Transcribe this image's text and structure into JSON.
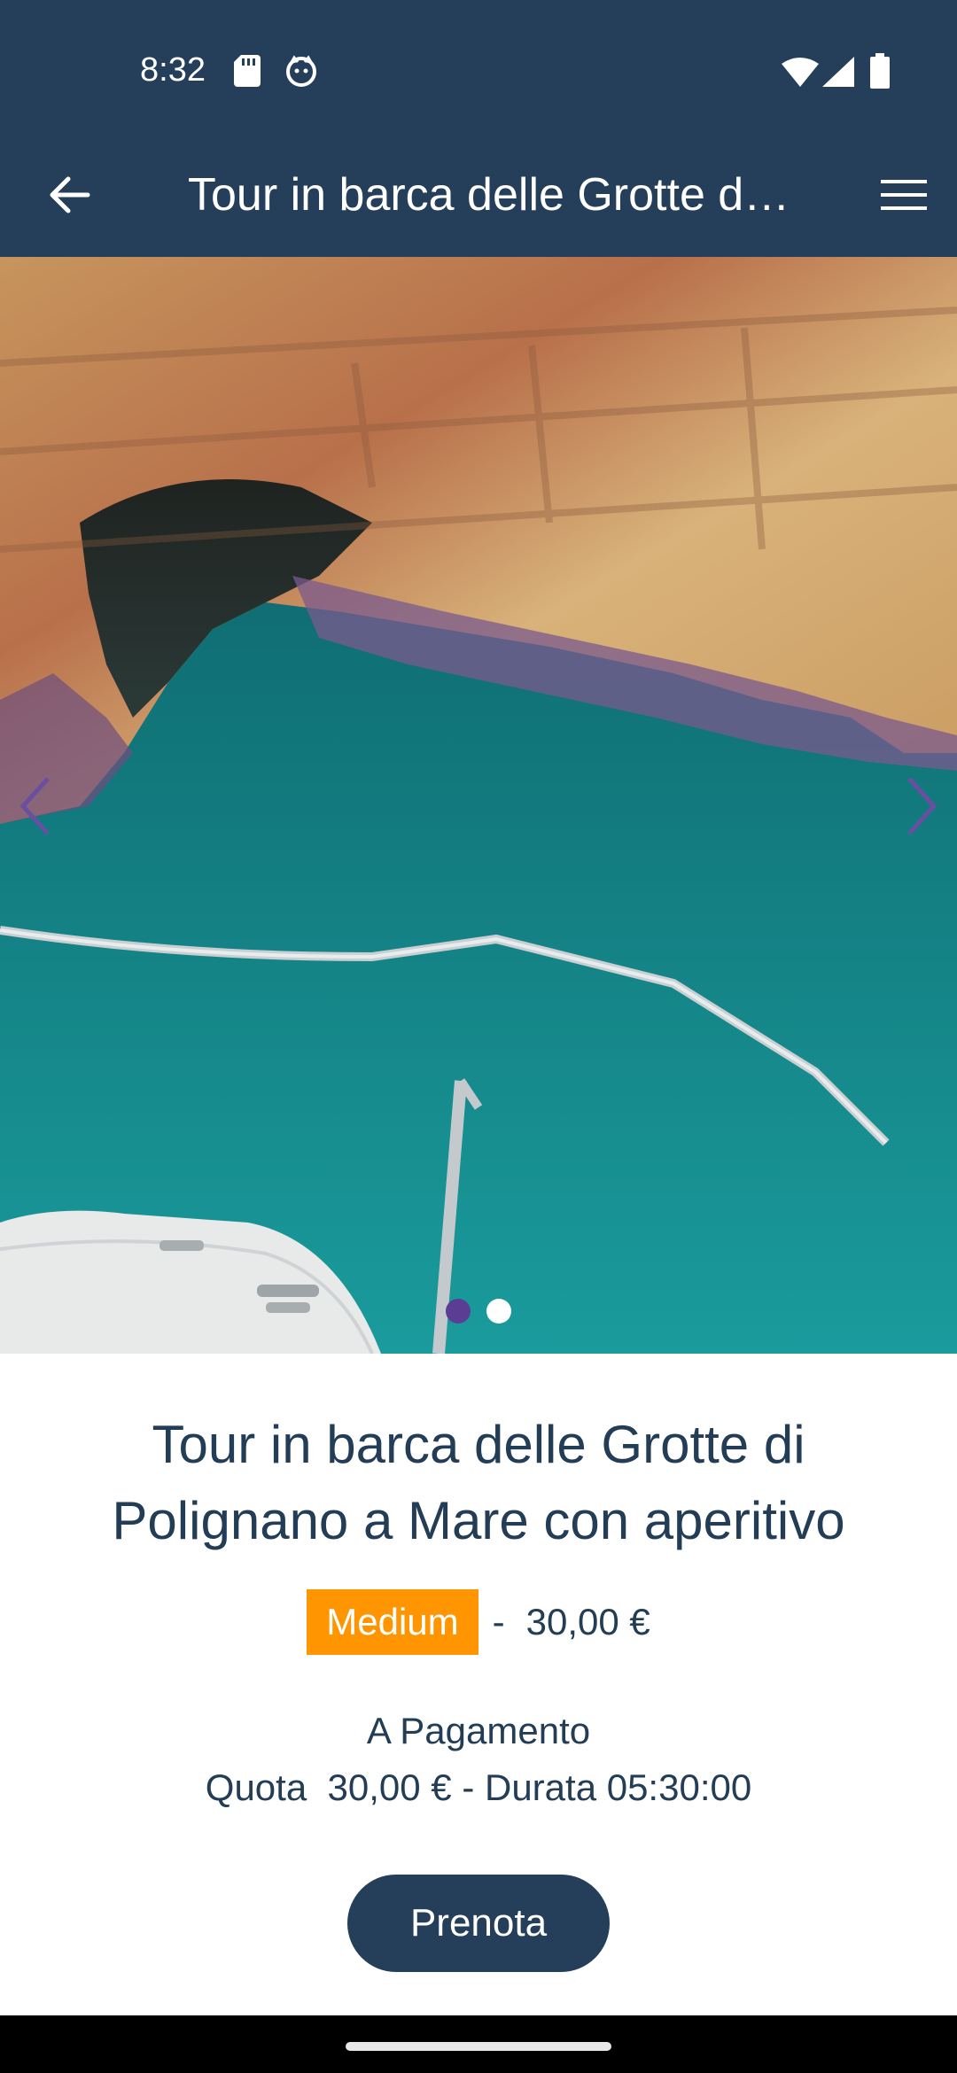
{
  "status_bar": {
    "time": "8:32",
    "icons": [
      "sd-card-icon",
      "cat-face-icon",
      "wifi-icon",
      "signal-icon",
      "battery-icon"
    ]
  },
  "app_bar": {
    "title": "Tour in barca delle Grotte di Polignano a Mare con aperitivo",
    "back_icon": "arrow-left-icon",
    "menu_icon": "hamburger-menu-icon",
    "background_color": "#253f5a"
  },
  "carousel": {
    "image_subject": "sea cave with boat bow",
    "prev_icon": "chevron-left-icon",
    "next_icon": "chevron-right-icon",
    "slide_count": 2,
    "active_index": 0,
    "active_dot_color": "#5b3d93"
  },
  "tour": {
    "title": "Tour in barca delle Grotte di Polignano a Mare con aperitivo",
    "level": "Medium",
    "level_color": "#ff9500",
    "separator": "-",
    "price": "30,00 €",
    "payment_label": "A Pagamento",
    "details": "Quota  30,00 € - Durata 05:30:00",
    "book_label": "Prenota",
    "text_color": "#233d57"
  }
}
